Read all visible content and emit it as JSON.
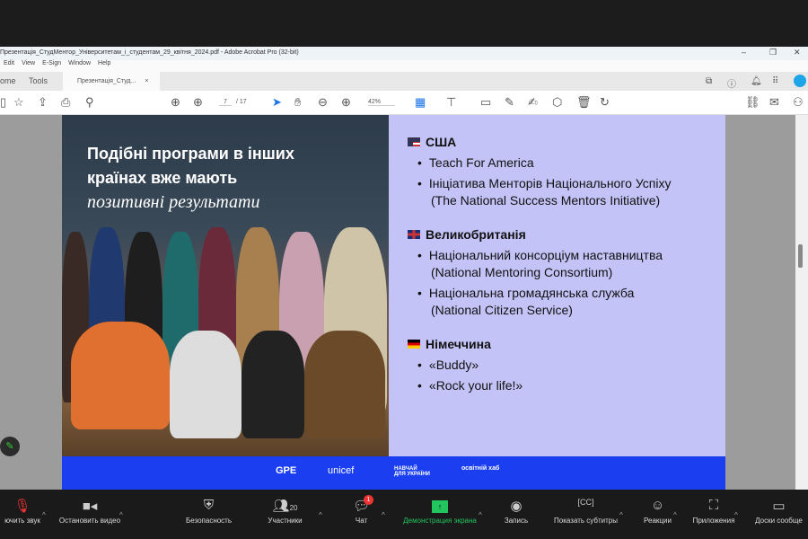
{
  "window": {
    "title": "Презентація_СтудМентор_Університетам_і_студентам_29_квітня_2024.pdf - Adobe Acrobat Pro (32-bit)",
    "minimize": "–",
    "restore": "❐",
    "close": "✕"
  },
  "menu": [
    "Edit",
    "View",
    "E-Sign",
    "Window",
    "Help"
  ],
  "tabs": {
    "home": "ome",
    "tools": "Tools",
    "document": "Презентація_Студ...",
    "close": "×"
  },
  "toolbar": {
    "page_current": "7",
    "page_total": "/ 17",
    "zoom": "42%"
  },
  "slide": {
    "headline_line1": "Подібні програми в інших",
    "headline_line2": "країнах вже мають",
    "headline_line3": "позитивні результати",
    "countries": [
      {
        "name": "США",
        "flag": "us-flag",
        "items": [
          "Teach For America",
          "Ініціатива Менторів Національного Успіху"
        ],
        "sub": "(The National Success Mentors Initiative)"
      },
      {
        "name": "Великобританія",
        "flag": "uk-flag",
        "items": [
          "Національний консорціум наставництва",
          "Національна громадянська служба"
        ],
        "subs": [
          "(National Mentoring Consortium)",
          "(National Citizen Service)"
        ]
      },
      {
        "name": "Німеччина",
        "flag": "de-flag",
        "items": [
          "«Buddy»",
          "«Rock your life!»"
        ]
      }
    ],
    "logos": [
      "GPE",
      "unicef",
      "НАВЧАЙ ДЛЯ УКРАЇНИ",
      "освітній хаб"
    ]
  },
  "zoom": {
    "mute": "ючить звук",
    "video": "Остановить видео",
    "security": "Безопасность",
    "participants": "Участники",
    "participants_count": "20",
    "chat": "Чат",
    "chat_badge": "1",
    "share": "Демонстрация экрана",
    "record": "Запись",
    "captions": "Показать субтитры",
    "reactions": "Реакции",
    "apps": "Приложения",
    "whiteboards": "Доски сообще"
  },
  "colors": {
    "slide_bg": "#c3c3f7",
    "footer_blue": "#1b3ff0",
    "share_green": "#22c55e"
  }
}
